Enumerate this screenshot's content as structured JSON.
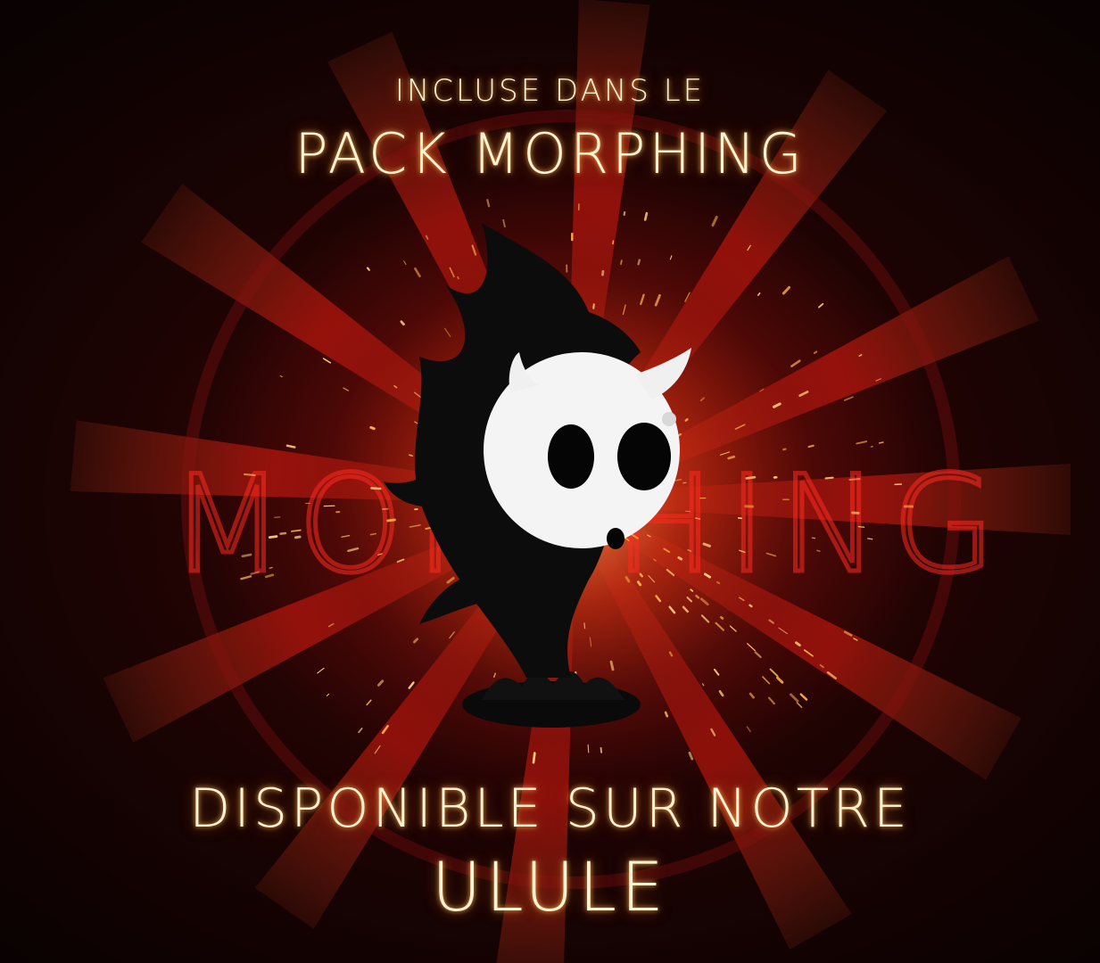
{
  "poster": {
    "subtitle": "INCLUSE DANS LE",
    "title": "PACK MORPHING",
    "cta_line1": "DISPONIBLE SUR NOTRE",
    "cta_line2": "ULULE",
    "background_word": "MORPHING"
  },
  "colors": {
    "glow_text": "#fff2d2",
    "background_red": "#c2381a",
    "background_dark": "#0a0202",
    "figure_body": "#0c0c0c",
    "mask_white": "#f4f4f4"
  },
  "figure": {
    "icon": "ghost-mask-figurine-icon"
  }
}
